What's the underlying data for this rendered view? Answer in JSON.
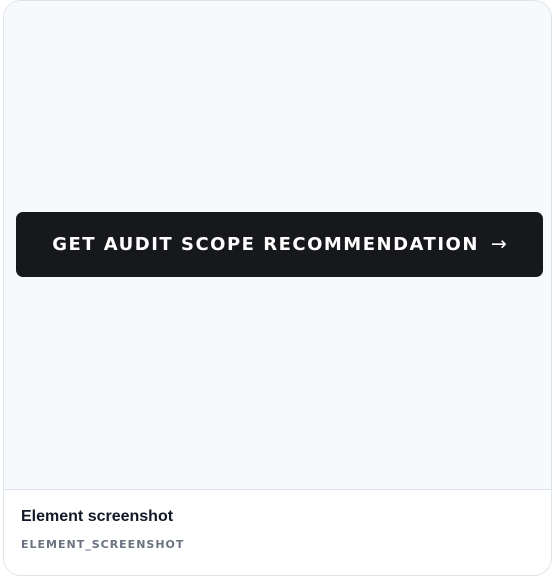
{
  "preview": {
    "button": {
      "label": "GET AUDIT SCOPE RECOMMENDATION",
      "arrow": "→",
      "background": "#17181c",
      "text_color": "#ffffff"
    }
  },
  "footer": {
    "title": "Element screenshot",
    "subtitle": "ELEMENT_SCREENSHOT"
  }
}
